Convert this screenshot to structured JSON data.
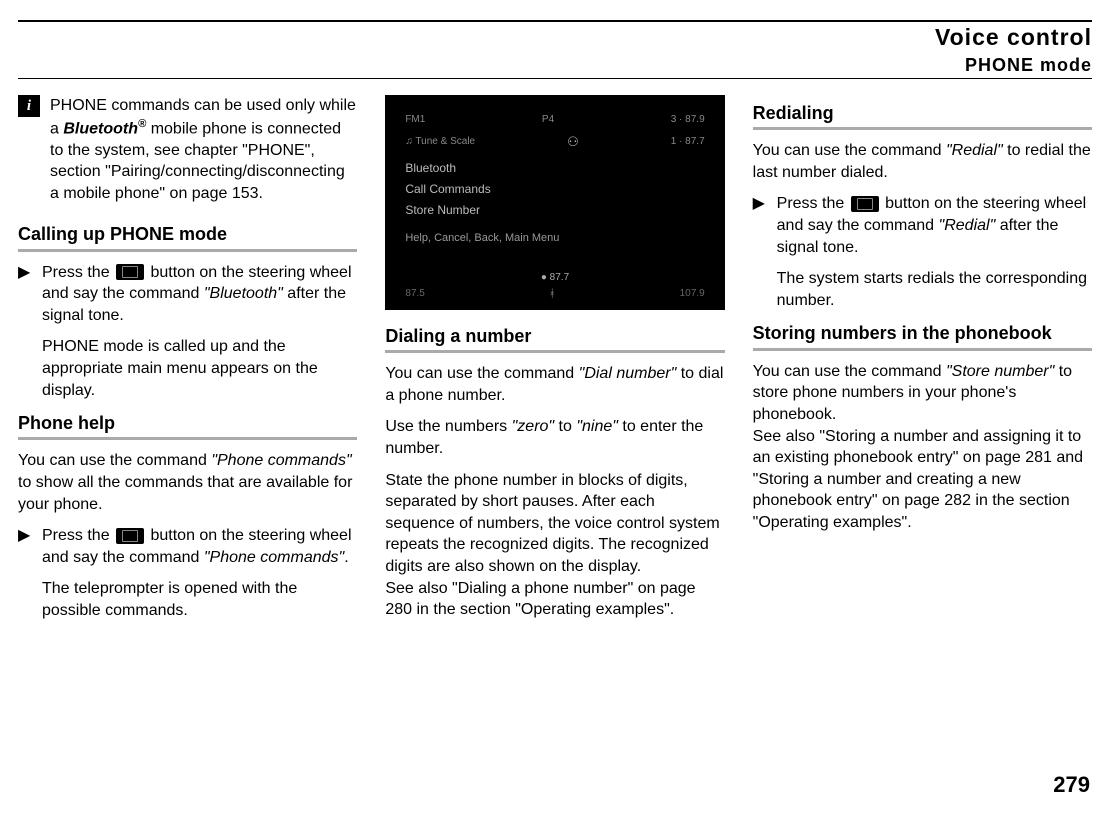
{
  "header": {
    "title": "Voice control",
    "subtitle": "PHONE mode"
  },
  "col1": {
    "info_note": {
      "t1": "PHONE commands can be used only while a ",
      "bt": "Bluetooth",
      "reg": "®",
      "t2": " mobile phone is connected to the system, see chapter \"PHONE\", section \"Pairing/connecting/disconnecting a mobile phone\" on page 153."
    },
    "sec1_title": "Calling up PHONE mode",
    "sec1_step_a": "Press the ",
    "sec1_step_b": " button on the steering wheel and say the command ",
    "sec1_step_cmd": "\"Bluetooth\"",
    "sec1_step_c": " after the signal tone.",
    "sec1_result": "PHONE mode is called up and the appropriate main menu appears on the display.",
    "sec2_title": "Phone help",
    "sec2_intro_a": "You can use the command ",
    "sec2_intro_cmd": "\"Phone commands\"",
    "sec2_intro_b": " to show all the commands that are available for your phone.",
    "sec2_step_a": "Press the ",
    "sec2_step_b": " button on the steering wheel and say the command ",
    "sec2_step_cmd": "\"Phone commands\"",
    "sec2_step_c": ".",
    "sec2_result": "The teleprompter is opened with the possible commands."
  },
  "col2": {
    "screenshot": {
      "top_left": "FM1",
      "top_mid": "P4",
      "top_right": "3 · 87.9",
      "line2_left": "Tune & Scale",
      "line2_right": "1 · 87.7",
      "menu1": "Bluetooth",
      "menu2": "Call Commands",
      "menu3": "Store Number",
      "help": "Help, Cancel, Back, Main Menu",
      "freq": "● 87.7",
      "bot_left": "87.5",
      "bot_right": "107.9"
    },
    "sec1_title": "Dialing a number",
    "p1_a": "You can use the command ",
    "p1_cmd": "\"Dial number\"",
    "p1_b": " to dial a phone number.",
    "p2_a": "Use the numbers ",
    "p2_zero": "\"zero\"",
    "p2_b": " to ",
    "p2_nine": "\"nine\"",
    "p2_c": " to enter the number.",
    "p3": "State the phone number in blocks of digits, separated by short pauses. After each sequence of numbers, the voice control system repeats the recognized digits. The recognized digits are also shown on the display.",
    "p3b": "See also \"Dialing a phone number\" on page 280 in the section \"Operating examples\"."
  },
  "col3": {
    "sec1_title": "Redialing",
    "p1_a": "You can use the command ",
    "p1_cmd": "\"Redial\"",
    "p1_b": " to redial the last number dialed.",
    "step_a": "Press the ",
    "step_b": " button on the steering wheel and say the command ",
    "step_cmd": "\"Redial\"",
    "step_c": " after the signal tone.",
    "step_result": "The system starts redials the corresponding number.",
    "sec2_title": "Storing numbers in the phonebook",
    "p3_a": "You can use the command ",
    "p3_cmd": "\"Store number\"",
    "p3_b": " to store phone numbers in your phone's phonebook.",
    "p3c": "See also \"Storing a number and assigning it to an existing phonebook entry\" on page 281 and \"Storing a number and creating a new phonebook entry\" on page 282 in the section \"Operating examples\"."
  },
  "page_number": "279"
}
